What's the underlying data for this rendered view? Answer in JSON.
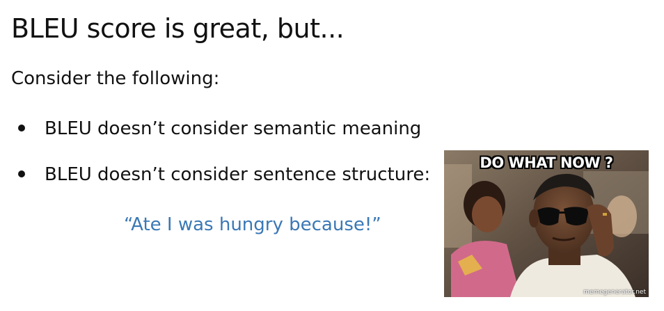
{
  "slide": {
    "title": "BLEU score is great, but...",
    "intro": "Consider the following:",
    "bullets": [
      "BLEU doesn’t consider semantic meaning",
      "BLEU doesn’t consider sentence structure:"
    ],
    "quote": "“Ate I was hungry because!”",
    "quote_color": "#3a78b5"
  },
  "meme": {
    "caption": "DO WHAT NOW ?",
    "watermark": "memegenerator.net"
  }
}
